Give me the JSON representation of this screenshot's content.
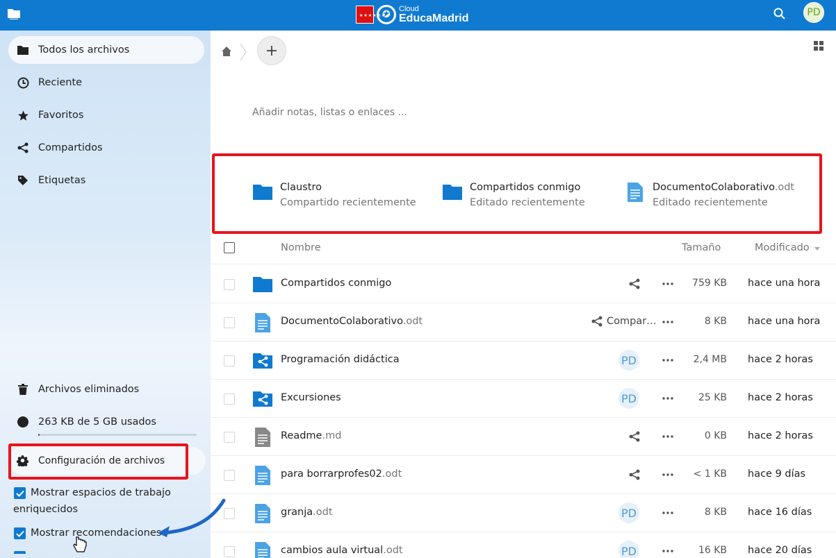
{
  "header": {
    "brand_small": "Cloud",
    "brand_big": "EducaMadrid",
    "avatar_initials": "PD",
    "accent_color": "#0f7ad0",
    "icons": [
      "folder-app-icon",
      "search-icon"
    ]
  },
  "sidebar": {
    "items": [
      {
        "label": "Todos los archivos",
        "icon": "folder-icon"
      },
      {
        "label": "Reciente",
        "icon": "clock-icon"
      },
      {
        "label": "Favoritos",
        "icon": "star-icon"
      },
      {
        "label": "Compartidos",
        "icon": "share-icon"
      },
      {
        "label": "Etiquetas",
        "icon": "tag-icon"
      }
    ],
    "deleted_label": "Archivos eliminados",
    "quota_label": "263 KB de 5 GB usados",
    "quota_fraction": 0.01,
    "settings_label": "Configuración de archivos",
    "checkboxes": [
      {
        "label_line1": "Mostrar espacios de trabajo",
        "label_line2": "enriquecidos",
        "checked": true
      },
      {
        "label_line1": "Mostrar recomendaciones",
        "checked": true
      }
    ]
  },
  "main": {
    "notes_placeholder": "Añadir notas, listas o enlaces ...",
    "recommendations": [
      {
        "name": "Claustro",
        "ext": "",
        "subtitle": "Compartido recientemente",
        "icon": "folder-icon"
      },
      {
        "name": "Compartidos conmigo",
        "ext": "",
        "subtitle": "Editado recientemente",
        "icon": "folder-icon"
      },
      {
        "name": "DocumentoColaborativo",
        "ext": ".odt",
        "subtitle": "Editado recientemente",
        "icon": "document-icon"
      }
    ],
    "columns": {
      "name": "Nombre",
      "size": "Tamaño",
      "modified": "Modificado"
    },
    "files": [
      {
        "name": "Compartidos conmigo",
        "ext": "",
        "icon": "folder",
        "share": "icon",
        "size": "759 KB",
        "modified": "hace una hora"
      },
      {
        "name": "DocumentoColaborativo",
        "ext": ".odt",
        "icon": "doc",
        "share": "text",
        "share_text": "Compar…",
        "size": "8 KB",
        "modified": "hace una hora"
      },
      {
        "name": "Programación didáctica",
        "ext": "",
        "icon": "shared-folder",
        "share": "avatar",
        "share_text": "PD",
        "size": "2,4 MB",
        "modified": "hace 2 horas"
      },
      {
        "name": "Excursiones",
        "ext": "",
        "icon": "shared-folder",
        "share": "avatar",
        "share_text": "PD",
        "size": "25 KB",
        "modified": "hace 2 horas"
      },
      {
        "name": "Readme",
        "ext": ".md",
        "icon": "text",
        "share": "icon",
        "size": "0 KB",
        "modified": "hace 2 horas"
      },
      {
        "name": "para borrarprofes02",
        "ext": ".odt",
        "icon": "doc",
        "share": "icon",
        "size": "< 1 KB",
        "modified": "hace 9 días"
      },
      {
        "name": "granja",
        "ext": ".odt",
        "icon": "doc",
        "share": "avatar",
        "share_text": "PD",
        "size": "8 KB",
        "modified": "hace 16 días"
      },
      {
        "name": "cambios aula virtual",
        "ext": ".odt",
        "icon": "doc",
        "share": "avatar",
        "share_text": "PD",
        "size": "16 KB",
        "modified": "hace 20 días"
      }
    ]
  }
}
